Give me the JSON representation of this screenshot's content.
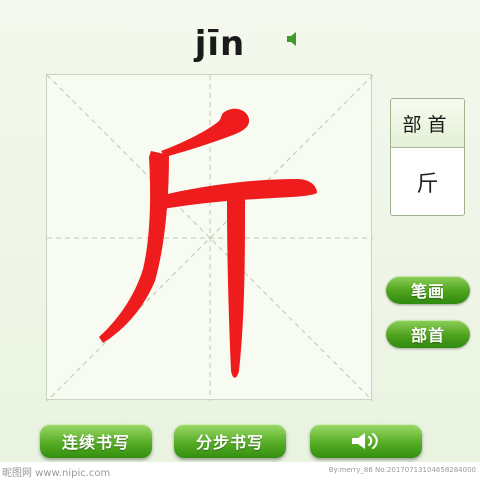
{
  "header": {
    "pinyin": "jīn",
    "speaker_icon": "speaker-icon"
  },
  "practice_grid": {
    "character": "斤",
    "stroke_color": "#ee1c1c",
    "guide_color": "#b9c7ab"
  },
  "radical_panel": {
    "title": "部首",
    "value": "斤"
  },
  "side_buttons": {
    "strokes_label": "笔画",
    "radical_label": "部首"
  },
  "bottom_buttons": {
    "continuous_label": "连续书写",
    "step_label": "分步书写",
    "audio_icon": "speaker-wave-icon"
  },
  "colors": {
    "accent_green": "#4ea21d",
    "background": "#eef5e6"
  },
  "footer": {
    "left_text": "昵图网 www.nipic.com",
    "right_text": "By:merry_86 No:20170713104658284000"
  }
}
